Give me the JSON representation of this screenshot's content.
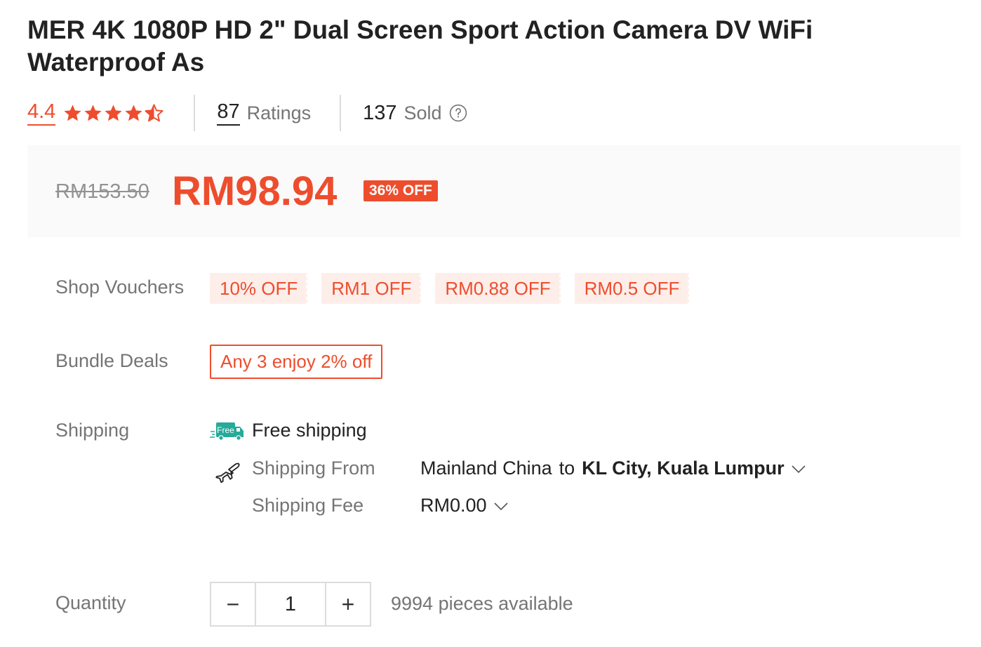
{
  "product": {
    "title": "MER 4K 1080P HD 2\" Dual Screen Sport Action Camera DV WiFi Waterproof As"
  },
  "rating": {
    "value": "4.4",
    "stars": 4.4,
    "count": "87",
    "count_label": "Ratings",
    "sold": "137",
    "sold_label": "Sold"
  },
  "price": {
    "original": "RM153.50",
    "current": "RM98.94",
    "discount_badge": "36% OFF"
  },
  "vouchers": {
    "label": "Shop Vouchers",
    "items": [
      "10% OFF",
      "RM1 OFF",
      "RM0.88 OFF",
      "RM0.5 OFF"
    ]
  },
  "bundle": {
    "label": "Bundle Deals",
    "deal": "Any 3 enjoy 2% off"
  },
  "shipping": {
    "label": "Shipping",
    "free_badge": "Free",
    "free_text": "Free shipping",
    "from_label": "Shipping From",
    "from_value": "Mainland China",
    "to_word": "to",
    "destination": "KL City, Kuala Lumpur",
    "fee_label": "Shipping Fee",
    "fee_value": "RM0.00"
  },
  "quantity": {
    "label": "Quantity",
    "minus": "−",
    "plus": "+",
    "value": "1",
    "available": "9994 pieces available"
  },
  "colors": {
    "accent": "#ee4d2d",
    "muted": "#757575",
    "free_green": "#26aa99"
  }
}
